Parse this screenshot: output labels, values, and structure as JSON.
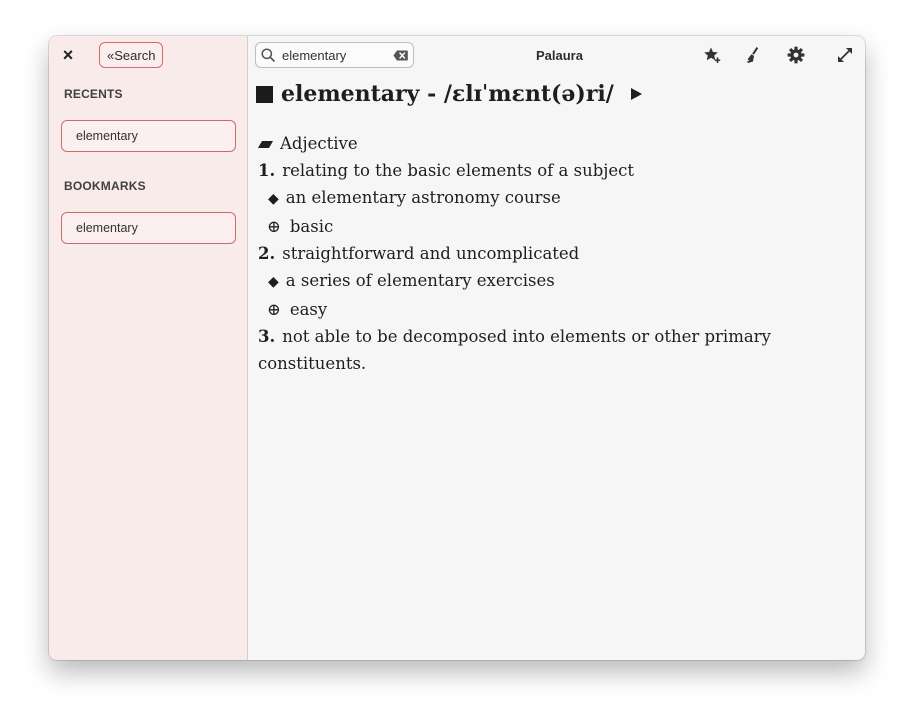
{
  "sidebar": {
    "close_label": "×",
    "search_button_label": "«Search",
    "recents_title": "RECENTS",
    "recents": [
      {
        "label": "elementary"
      }
    ],
    "bookmarks_title": "BOOKMARKS",
    "bookmarks": [
      {
        "label": "elementary"
      }
    ]
  },
  "toolbar": {
    "search_value": "elementary",
    "app_title": "Palaura",
    "icons": [
      "search-icon",
      "clear-icon",
      "add-bookmark-icon",
      "brush-icon",
      "gear-icon",
      "fullscreen-icon"
    ]
  },
  "entry": {
    "heading": "elementary - /ɛlɪˈmɛnt(ə)ri/",
    "part_of_speech": "Adjective",
    "senses": [
      {
        "number": "1.",
        "definition": "relating to the basic elements of a subject",
        "example": "an elementary astronomy course",
        "synonym": "basic"
      },
      {
        "number": "2.",
        "definition": "straightforward and uncomplicated",
        "example": "a series of elementary exercises",
        "synonym": "easy"
      },
      {
        "number": "3.",
        "definition": "not able to be decomposed into elements or other primary constituents."
      }
    ],
    "example_bullet": "◆",
    "synonym_bullet": "⊕"
  },
  "colors": {
    "sidebar_bg": "#faebeb",
    "accent_border": "#d8686b",
    "content_bg": "#f6f6f6"
  }
}
